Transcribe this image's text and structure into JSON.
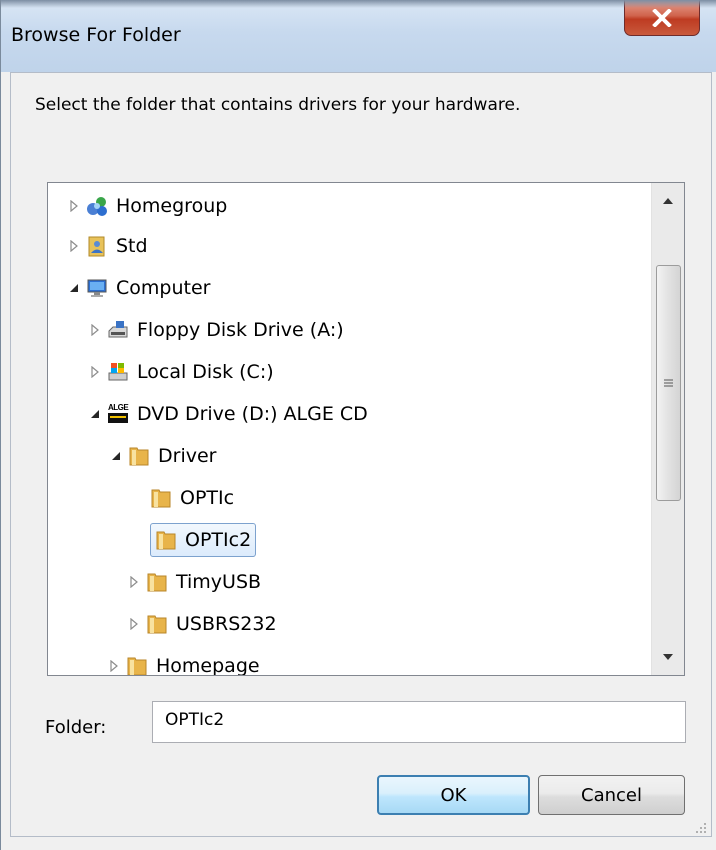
{
  "window": {
    "title": "Browse For Folder",
    "close_icon": "close-x-icon"
  },
  "instruction": "Select the folder that contains drivers for your hardware.",
  "tree": {
    "items": [
      {
        "label": "Homegroup",
        "icon": "homegroup-icon",
        "expander": "collapsed"
      },
      {
        "label": "Std",
        "icon": "user-folder-icon",
        "expander": "collapsed"
      },
      {
        "label": "Computer",
        "icon": "computer-icon",
        "expander": "expanded"
      },
      {
        "label": "Floppy Disk Drive (A:)",
        "icon": "floppy-drive-icon",
        "expander": "collapsed"
      },
      {
        "label": "Local Disk (C:)",
        "icon": "local-disk-icon",
        "expander": "collapsed"
      },
      {
        "label": "DVD Drive (D:) ALGE CD",
        "icon": "dvd-drive-icon",
        "expander": "expanded"
      },
      {
        "label": "Driver",
        "icon": "folder-icon",
        "expander": "expanded"
      },
      {
        "label": "OPTIc",
        "icon": "folder-icon",
        "expander": "none"
      },
      {
        "label": "OPTIc2",
        "icon": "folder-icon",
        "expander": "none",
        "selected": true
      },
      {
        "label": "TimyUSB",
        "icon": "folder-icon",
        "expander": "collapsed"
      },
      {
        "label": "USBRS232",
        "icon": "folder-icon",
        "expander": "collapsed"
      },
      {
        "label": "Homepage",
        "icon": "folder-icon",
        "expander": "collapsed"
      }
    ],
    "dvd_icon_text": "ALGE"
  },
  "folder": {
    "label": "Folder:",
    "value": "OPTIc2"
  },
  "buttons": {
    "ok": "OK",
    "cancel": "Cancel"
  }
}
